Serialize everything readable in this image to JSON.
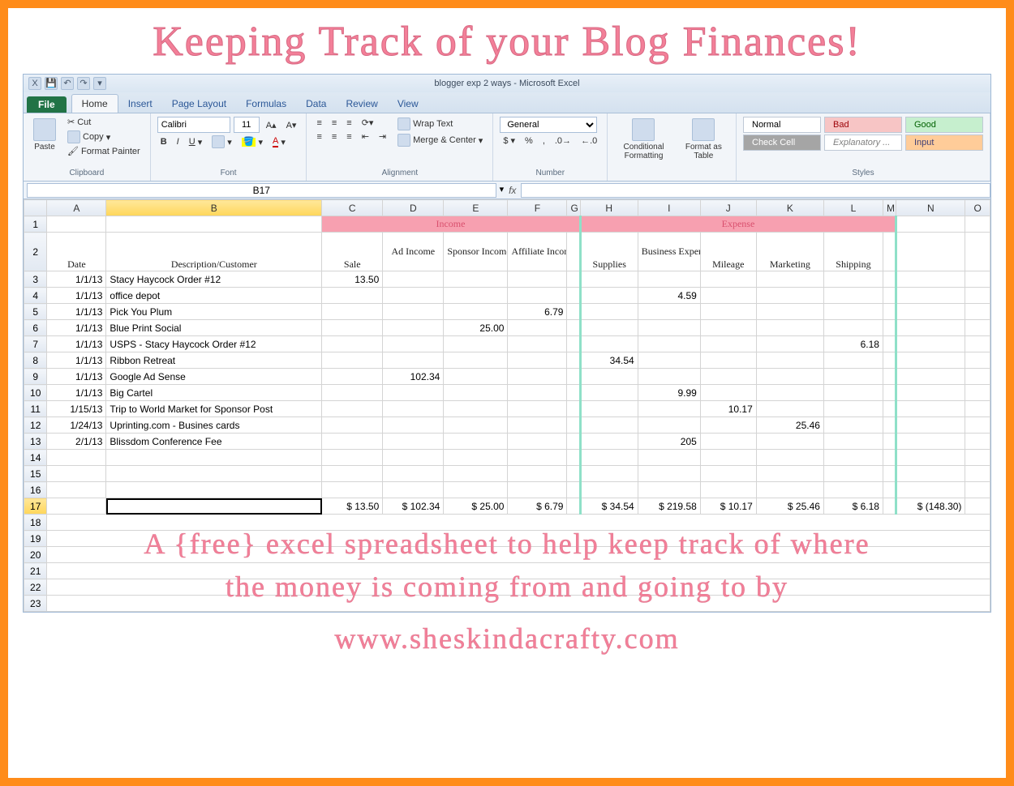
{
  "hero": {
    "main_title": "Keeping Track of your Blog Finances!",
    "line1": "A {free} excel spreadsheet to help keep track of where",
    "line2": "the money is coming from and going to by",
    "line3": "www.sheskindacrafty.com"
  },
  "window": {
    "title": "blogger exp 2 ways - Microsoft Excel"
  },
  "tabs": {
    "file": "File",
    "home": "Home",
    "insert": "Insert",
    "page_layout": "Page Layout",
    "formulas": "Formulas",
    "data": "Data",
    "review": "Review",
    "view": "View"
  },
  "ribbon": {
    "clipboard": {
      "label": "Clipboard",
      "cut": "Cut",
      "copy": "Copy",
      "painter": "Format Painter",
      "paste": "Paste"
    },
    "font": {
      "label": "Font",
      "name": "Calibri",
      "size": "11"
    },
    "alignment": {
      "label": "Alignment",
      "wrap": "Wrap Text",
      "merge": "Merge & Center"
    },
    "number": {
      "label": "Number",
      "format": "General"
    },
    "cond": "Conditional Formatting",
    "table": "Format as Table",
    "styles": {
      "label": "Styles",
      "normal": "Normal",
      "bad": "Bad",
      "good": "Good",
      "check": "Check Cell",
      "expl": "Explanatory ...",
      "input": "Input"
    }
  },
  "formula_bar": {
    "cell_ref": "B17",
    "fx": "fx",
    "value": ""
  },
  "columns": [
    "",
    "A",
    "B",
    "C",
    "D",
    "E",
    "F",
    "G",
    "H",
    "I",
    "J",
    "K",
    "L",
    "M",
    "N",
    "O"
  ],
  "sections": {
    "income": "Income",
    "expense": "Expense"
  },
  "headers": {
    "date": "Date",
    "desc": "Description/Customer",
    "sale": "Sale",
    "ad": "Ad Income",
    "sponsor": "Sponsor Income",
    "affiliate": "Affiliate Income",
    "supplies": "Supplies",
    "bizexp": "Business Expense",
    "mileage": "Mileage",
    "marketing": "Marketing",
    "shipping": "Shipping"
  },
  "rows": [
    {
      "n": 3,
      "date": "1/1/13",
      "desc": "Stacy Haycock Order #12",
      "sale": "13.50"
    },
    {
      "n": 4,
      "date": "1/1/13",
      "desc": "office depot",
      "bizexp": "4.59"
    },
    {
      "n": 5,
      "date": "1/1/13",
      "desc": "Pick You Plum",
      "affiliate": "6.79"
    },
    {
      "n": 6,
      "date": "1/1/13",
      "desc": "Blue Print Social",
      "sponsor": "25.00"
    },
    {
      "n": 7,
      "date": "1/1/13",
      "desc": "USPS - Stacy Haycock Order #12",
      "shipping": "6.18"
    },
    {
      "n": 8,
      "date": "1/1/13",
      "desc": "Ribbon Retreat",
      "supplies": "34.54"
    },
    {
      "n": 9,
      "date": "1/1/13",
      "desc": "Google Ad Sense",
      "ad": "102.34"
    },
    {
      "n": 10,
      "date": "1/1/13",
      "desc": "Big Cartel",
      "bizexp": "9.99"
    },
    {
      "n": 11,
      "date": "1/15/13",
      "desc": "Trip to World Market for Sponsor Post",
      "mileage": "10.17"
    },
    {
      "n": 12,
      "date": "1/24/13",
      "desc": "Uprinting.com - Busines cards",
      "marketing": "25.46"
    },
    {
      "n": 13,
      "date": "2/1/13",
      "desc": "Blissdom Conference Fee",
      "bizexp": "205"
    }
  ],
  "totals": {
    "sale": "$   13.50",
    "ad": "$   102.34",
    "sponsor": "$   25.00",
    "affiliate": "$   6.79",
    "supplies": "$   34.54",
    "bizexp": "$   219.58",
    "mileage": "$   10.17",
    "marketing": "$   25.46",
    "shipping": "$   6.18",
    "net": "$  (148.30)"
  }
}
